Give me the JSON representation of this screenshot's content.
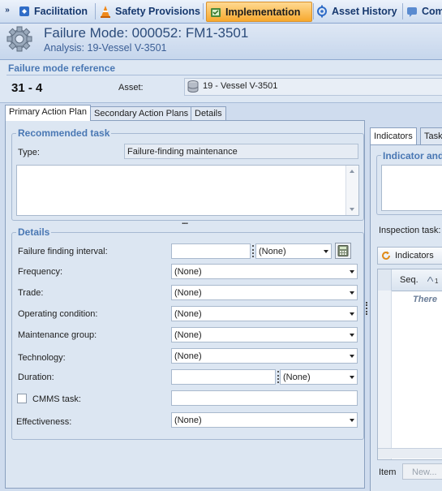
{
  "nav": {
    "chevron": "»",
    "tabs": [
      {
        "label": "Facilitation",
        "icon": "facilitation-icon"
      },
      {
        "label": "Safety Provisions",
        "icon": "traffic-cone-icon"
      },
      {
        "label": "Implementation",
        "icon": "implementation-icon",
        "active": true
      },
      {
        "label": "Asset History",
        "icon": "asset-history-icon"
      },
      {
        "label": "Com",
        "icon": "communication-icon"
      }
    ]
  },
  "header": {
    "title": "Failure Mode: 000052: FM1-3501",
    "subtitle": "Analysis: 19-Vessel V-3501",
    "icon": "gear-icon"
  },
  "reference": {
    "section_title": "Failure mode reference",
    "code": "31  -  4",
    "asset_label": "Asset:",
    "asset_value": "19 - Vessel V-3501",
    "asset_icon": "database-icon"
  },
  "tabs": [
    "Primary Action Plan",
    "Secondary Action Plans",
    "Details"
  ],
  "recommended": {
    "title": "Recommended task",
    "type_label": "Type:",
    "type_value": "Failure-finding maintenance",
    "splitter": "....",
    "description": ""
  },
  "details": {
    "title": "Details",
    "interval_label": "Failure finding interval:",
    "interval_value": "",
    "interval_unit": "(None)",
    "frequency_label": "Frequency:",
    "frequency_value": "(None)",
    "trade_label": "Trade:",
    "trade_value": "(None)",
    "opcond_label": "Operating condition:",
    "opcond_value": "(None)",
    "maintgroup_label": "Maintenance group:",
    "maintgroup_value": "(None)",
    "technology_label": "Technology:",
    "technology_value": "(None)",
    "duration_label": "Duration:",
    "duration_value": "",
    "duration_unit": "(None)",
    "cmms_label": "CMMS task:",
    "cmms_checked": false,
    "cmms_value": "",
    "effectiveness_label": "Effectiveness:",
    "effectiveness_value": "(None)"
  },
  "right": {
    "tabs": [
      "Indicators",
      "Task"
    ],
    "indicator_section": "Indicator and",
    "inspection_label": "Inspection task:",
    "indicators_button": "Indicators",
    "col_seq": "Seq.",
    "sort_marker": "1",
    "empty_text": "There",
    "item_label": "Item",
    "new_button": "New..."
  },
  "colors": {
    "accent": "#4a78b4",
    "active_tab": "#f7a92e",
    "panel": "#dce6f2"
  }
}
